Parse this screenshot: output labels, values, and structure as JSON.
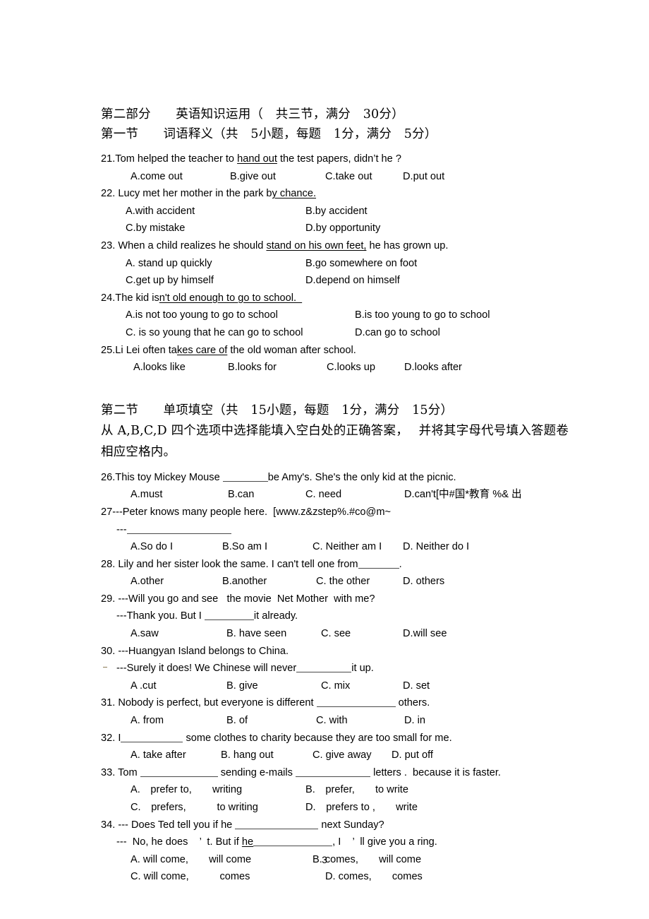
{
  "document": {
    "page_number": "3"
  },
  "part_heading": "第二部分　　英语知识运用（　共三节，满分　30分）",
  "section1": {
    "heading": "第一节　　词语释义（共　5小题，每题　1分，满分　5分）",
    "questions": [
      {
        "number": "21",
        "stem_pre": "21.Tom helped the teacher to ",
        "stem_underlined": "hand out",
        "stem_post": " the test papers, didn’t he ?",
        "options": [
          "A.come out",
          "B.give out",
          "C.take out",
          "D.put out"
        ],
        "layout": "row4"
      },
      {
        "number": "22",
        "stem_pre": "22. Lucy met her mother in the park b",
        "stem_underlined": "y chance.",
        "stem_post": " ",
        "options": [
          "A.with accident",
          "B.by accident",
          "C.by mistake",
          "D.by opportunity"
        ],
        "layout": "grid2"
      },
      {
        "number": "23",
        "stem_pre": "23. When a child realizes he should ",
        "stem_underlined": "stand on his own feet,",
        "stem_post": " he has grown up.",
        "options": [
          "A. stand up quickly",
          "B.go somewhere on foot",
          "C.get up by himself",
          "D.depend on himself"
        ],
        "layout": "grid2"
      },
      {
        "number": "24",
        "stem_pre": "24.The kid is",
        "stem_underlined": "n't old enough to go to school.  ",
        "stem_post": "",
        "options": [
          "A.is not too young to go to school",
          "B.is too young to go to school",
          "C. is so young that he can go to school",
          "D.can go to school"
        ],
        "layout": "grid2wide"
      },
      {
        "number": "25",
        "stem_pre": "25.Li Lei often ta",
        "stem_underlined": "kes care of",
        "stem_post": " the old woman after school.",
        "options": [
          "A.looks like",
          "B.looks for",
          "C.looks up",
          "D.looks after"
        ],
        "layout": "row4"
      }
    ]
  },
  "section2": {
    "heading": "第二节　　单项填空（共　15小题，每题　1分，满分　15分）",
    "instruction": "从 A,B,C,D 四个选项中选择能填入空白处的正确答案，　 并将其字母代号填入答题卷相应空格内。",
    "questions": [
      {
        "number": "26",
        "stem_a": "26.This toy Mickey Mouse ",
        "stem_b": "be Amy's. She's the only kid at the picnic.",
        "options": [
          "A.must",
          "B.can",
          "C. need",
          "D.can't[中#国*教育 %& 出"
        ],
        "layout": "row4"
      },
      {
        "number": "27",
        "line1": "27---Peter knows many people here.  [www.z&zstep%.#co@m~",
        "line2_dash": "---",
        "options": [
          "A.So do I",
          "B.So am I",
          "C. Neither am I",
          "D. Neither do I"
        ],
        "layout": "row4"
      },
      {
        "number": "28",
        "stem_a": "28. Lily and her sister look the same. I can't tell one from",
        "stem_b": ".",
        "options": [
          "A.other",
          "B.another",
          "C. the other",
          "D. others"
        ],
        "layout": "row4"
      },
      {
        "number": "29",
        "line1": "29. ---Will you go and see   the movie  Net Mother  with me?",
        "line2_a": "---Thank you. But I ",
        "line2_b": "it already.",
        "options": [
          "A.saw",
          "B. have seen",
          "C. see",
          "D.will see"
        ],
        "layout": "row4"
      },
      {
        "number": "30",
        "line1": "30. ---Huangyan Island belongs to China.",
        "line2_a": "---Surely it does! We Chinese will never",
        "line2_b": "it up.",
        "options": [
          "A .cut",
          "B. give",
          "C. mix",
          "D. set"
        ],
        "layout": "row4"
      },
      {
        "number": "31",
        "stem_a": "31. Nobody is perfect, but everyone is different ",
        "stem_b": " others.",
        "options": [
          "A. from",
          "B. of",
          "C. with",
          "D. in"
        ],
        "layout": "row4"
      },
      {
        "number": "32",
        "stem_a": "32. I",
        "stem_b": " some clothes to charity because they are too small for me.",
        "options": [
          "A. take after",
          "B. hang out",
          "C. give away",
          "D. put off"
        ],
        "layout": "row4"
      },
      {
        "number": "33",
        "stem_a": "33. Tom ",
        "stem_b": " sending e-mails ",
        "stem_c": " letters .  because it is faster.",
        "options": [
          "A.　prefer to,　　writing",
          "B.　prefer,　　to write",
          "C.　prefers,　　　to writing",
          "D.　prefers to ,　　write"
        ],
        "layout": "grid2"
      },
      {
        "number": "34",
        "line1_a": "34. --- Does Ted tell you if he ",
        "line1_b": " next Sunday?",
        "line2_a": "---  No, he does    ’  t. But if ",
        "line2_underlined": "he",
        "line2_b": ", I    ’  ll give you a ring.",
        "options": [
          "A. will come,　　will come",
          "B. comes,　　will come",
          "C. will come,　　　comes",
          "D. comes,　　comes"
        ],
        "layout": "grid2"
      }
    ]
  }
}
